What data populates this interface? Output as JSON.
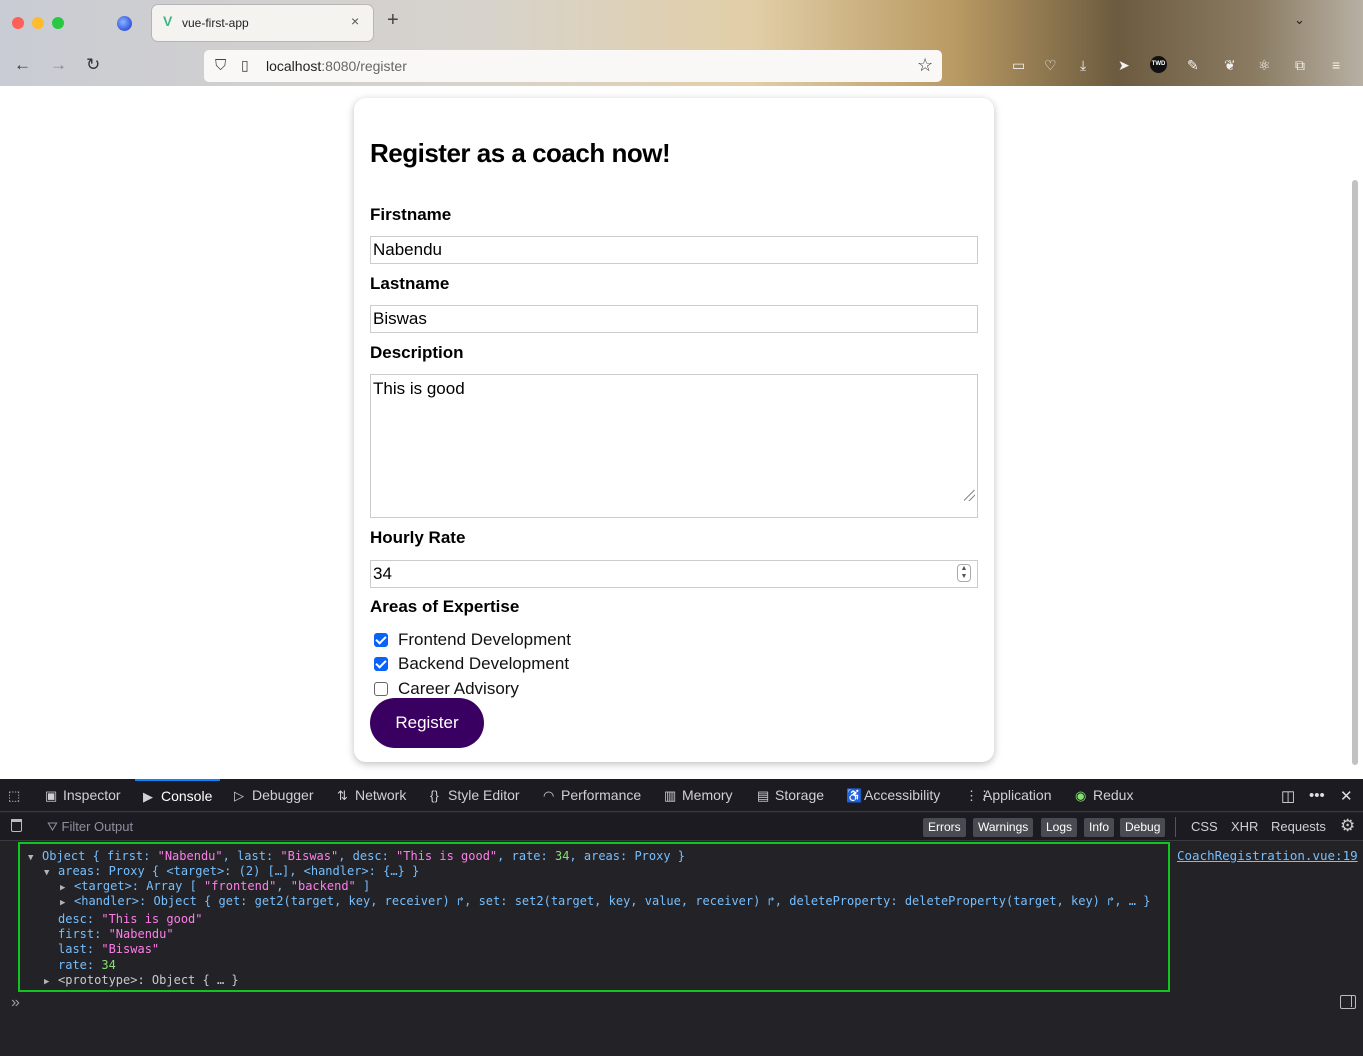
{
  "browser": {
    "tab_title": "vue-first-app",
    "tab_close": "×",
    "new_tab": "+",
    "tab_list": "⌄",
    "url_host": "localhost",
    "url_rest": ":8080/register",
    "twd_label": "TWD"
  },
  "form": {
    "heading": "Register as a coach now!",
    "firstname_label": "Firstname",
    "firstname_value": "Nabendu",
    "lastname_label": "Lastname",
    "lastname_value": "Biswas",
    "description_label": "Description",
    "description_value": "This is good",
    "rate_label": "Hourly Rate",
    "rate_value": "34",
    "areas_label": "Areas of Expertise",
    "areas": [
      {
        "label": "Frontend Development",
        "checked": true
      },
      {
        "label": "Backend Development",
        "checked": true
      },
      {
        "label": "Career Advisory",
        "checked": false
      }
    ],
    "submit_label": "Register"
  },
  "devtools": {
    "tabs": [
      "Inspector",
      "Console",
      "Debugger",
      "Network",
      "Style Editor",
      "Performance",
      "Memory",
      "Storage",
      "Accessibility",
      "Application",
      "Redux"
    ],
    "active_tab": "Console",
    "filter_placeholder": "Filter Output",
    "levels": [
      "Errors",
      "Warnings",
      "Logs",
      "Info",
      "Debug"
    ],
    "extra_filters": [
      "CSS",
      "XHR",
      "Requests"
    ],
    "source_link": "CoachRegistration.vue:19",
    "prompt": "»",
    "log": {
      "line1": [
        "Object { first: ",
        "\"Nabendu\"",
        ", last: ",
        "\"Biswas\"",
        ", desc: ",
        "\"This is good\"",
        ", rate: ",
        "34",
        ", areas: Proxy }"
      ],
      "line2": "areas: Proxy { <target>: (2) […], <handler>: {…} }",
      "line3_a": "<target>: Array [ ",
      "line3_b": "\"frontend\"",
      "line3_c": ", ",
      "line3_d": "\"backend\"",
      "line3_e": " ]",
      "line4": "<handler>: Object { get: get2(target, key, receiver) ↱, set: set2(target, key, value, receiver) ↱, deleteProperty: deleteProperty(target, key) ↱, … }",
      "desc_key": "desc: ",
      "desc_val": "\"This is good\"",
      "first_key": "first: ",
      "first_val": "\"Nabendu\"",
      "last_key": "last: ",
      "last_val": "\"Biswas\"",
      "rate_key": "rate: ",
      "rate_val": "34",
      "proto": "<prototype>: Object { … }"
    }
  }
}
